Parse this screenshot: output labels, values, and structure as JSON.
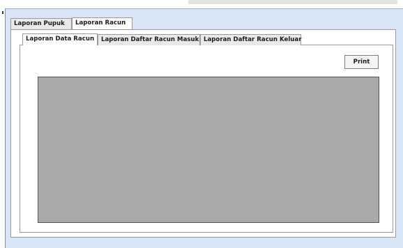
{
  "outer_tabs": [
    {
      "label": "Laporan Pupuk",
      "active": false
    },
    {
      "label": "Laporan Racun",
      "active": true
    }
  ],
  "inner_tabs": [
    {
      "label": "Laporan Data Racun",
      "active": true
    },
    {
      "label": "Laporan Daftar Racun Masuk",
      "active": false
    },
    {
      "label": "Laporan Daftar Racun Keluar",
      "active": false
    }
  ],
  "print_button": {
    "label": "Print"
  },
  "colors": {
    "window_background": "#d8e5f6",
    "panel_background": "#ffffff",
    "report_viewer_background": "#a9a9a9"
  }
}
